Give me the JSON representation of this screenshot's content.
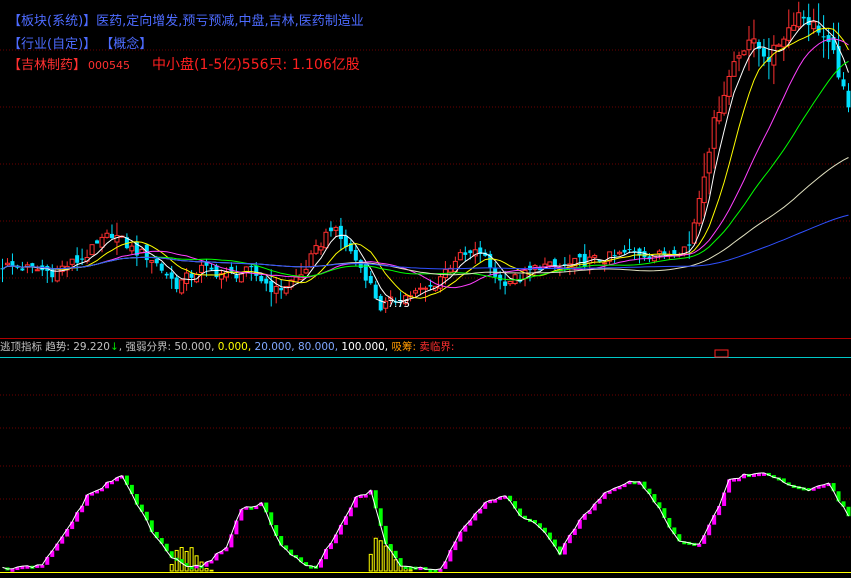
{
  "header": {
    "line1": "【板块(系统)】医药,定向增发,预亏预减,中盘,吉林,医药制造业",
    "line2": "【行业(自定)】 【概念】",
    "stock_name": "【吉林制药】",
    "stock_code": "000545",
    "summary": "中小盘(1-5亿)556只:  1.106亿股"
  },
  "indicator": {
    "name": "逃顶指标",
    "trend_label": "趋势:",
    "trend_value": "29.220",
    "trend_arrow": "↓",
    "bounds_label": "强弱分界:",
    "b1": "50.000,",
    "b2": "0.000,",
    "b3": "20.000,",
    "b4": "80.000,",
    "b5": "100.000,",
    "absorb": "吸筹:",
    "sell": "卖临界:"
  },
  "colors": {
    "up": "#ff3030",
    "down": "#00e0ff",
    "ma5": "#ffffff",
    "ma10": "#ffff00",
    "ma20": "#ff40ff",
    "ma30": "#00ff00",
    "ma60": "#e0e0c0",
    "ma120": "#3050ff",
    "osc_up": "#ff00ff",
    "osc_down": "#00ff00",
    "absorb": "#ffff00"
  },
  "chart_data": [
    {
      "type": "candlestick",
      "annotations": [
        {
          "label": "7.75",
          "bar_index": 75
        }
      ],
      "anchors": [
        [
          0,
          9.2
        ],
        [
          5,
          9.1
        ],
        [
          10,
          9.0
        ],
        [
          16,
          9.4
        ],
        [
          22,
          10.2
        ],
        [
          26,
          9.7
        ],
        [
          30,
          9.4
        ],
        [
          35,
          8.6
        ],
        [
          40,
          9.1
        ],
        [
          45,
          8.9
        ],
        [
          50,
          9.0
        ],
        [
          55,
          8.4
        ],
        [
          60,
          8.9
        ],
        [
          66,
          10.4
        ],
        [
          70,
          9.6
        ],
        [
          73,
          8.9
        ],
        [
          76,
          7.9
        ],
        [
          80,
          8.2
        ],
        [
          86,
          8.5
        ],
        [
          91,
          9.4
        ],
        [
          96,
          9.6
        ],
        [
          100,
          8.7
        ],
        [
          104,
          8.8
        ],
        [
          108,
          9.2
        ],
        [
          112,
          9.1
        ],
        [
          116,
          9.3
        ],
        [
          121,
          9.4
        ],
        [
          126,
          9.6
        ],
        [
          132,
          9.5
        ],
        [
          138,
          9.8
        ],
        [
          143,
          13.6
        ],
        [
          147,
          15.5
        ],
        [
          150,
          16.2
        ],
        [
          154,
          15.6
        ],
        [
          160,
          17.0
        ],
        [
          164,
          16.5
        ],
        [
          167,
          15.7
        ],
        [
          170,
          14.0
        ]
      ]
    },
    {
      "type": "bar",
      "name": "逃顶指标",
      "ylim": [
        0,
        100
      ],
      "anchors": [
        [
          0,
          2
        ],
        [
          4,
          3
        ],
        [
          8,
          5
        ],
        [
          12,
          30
        ],
        [
          17,
          66
        ],
        [
          22,
          80
        ],
        [
          24,
          84
        ],
        [
          27,
          60
        ],
        [
          30,
          35
        ],
        [
          34,
          12
        ],
        [
          37,
          5
        ],
        [
          40,
          3
        ],
        [
          45,
          22
        ],
        [
          48,
          55
        ],
        [
          52,
          60
        ],
        [
          56,
          22
        ],
        [
          60,
          7
        ],
        [
          63,
          4
        ],
        [
          66,
          25
        ],
        [
          71,
          65
        ],
        [
          74,
          70
        ],
        [
          77,
          25
        ],
        [
          80,
          5
        ],
        [
          84,
          2
        ],
        [
          88,
          1
        ],
        [
          92,
          35
        ],
        [
          97,
          60
        ],
        [
          101,
          66
        ],
        [
          104,
          50
        ],
        [
          108,
          38
        ],
        [
          112,
          16
        ],
        [
          116,
          45
        ],
        [
          121,
          70
        ],
        [
          125,
          78
        ],
        [
          128,
          80
        ],
        [
          132,
          55
        ],
        [
          136,
          25
        ],
        [
          140,
          24
        ],
        [
          143,
          48
        ],
        [
          146,
          80
        ],
        [
          150,
          86
        ],
        [
          154,
          86
        ],
        [
          158,
          76
        ],
        [
          162,
          72
        ],
        [
          166,
          78
        ],
        [
          170,
          48
        ]
      ],
      "absorb_anchors": [
        [
          0,
          0
        ],
        [
          33,
          0
        ],
        [
          35,
          18
        ],
        [
          37,
          28
        ],
        [
          39,
          12
        ],
        [
          41,
          2
        ],
        [
          43,
          0
        ],
        [
          73,
          0
        ],
        [
          75,
          26
        ],
        [
          77,
          36
        ],
        [
          79,
          10
        ],
        [
          81,
          3
        ],
        [
          83,
          0
        ],
        [
          86,
          0
        ],
        [
          170,
          0
        ]
      ]
    }
  ]
}
